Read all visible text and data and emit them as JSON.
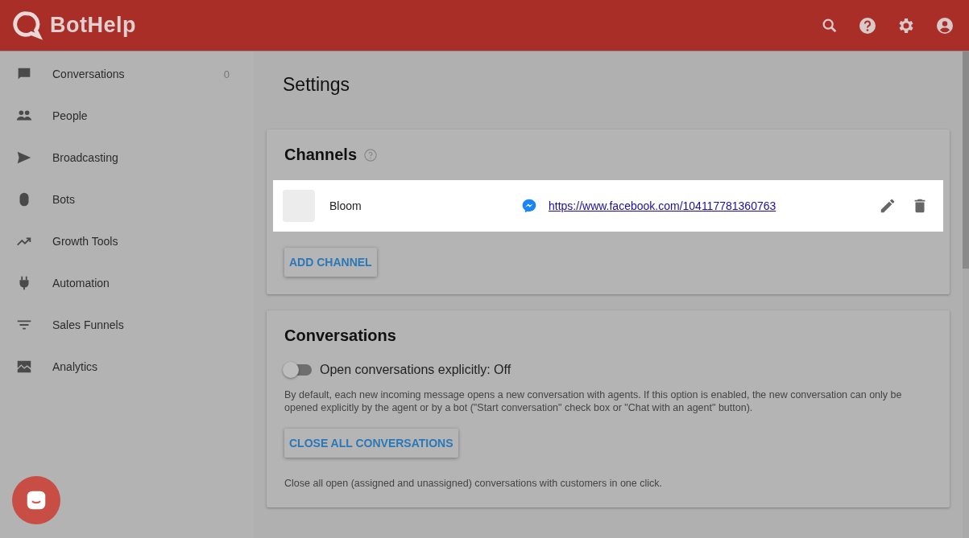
{
  "header": {
    "logo": "BotHelp"
  },
  "sidebar": {
    "items": [
      {
        "label": "Conversations",
        "count": "0"
      },
      {
        "label": "People"
      },
      {
        "label": "Broadcasting"
      },
      {
        "label": "Bots"
      },
      {
        "label": "Growth Tools"
      },
      {
        "label": "Automation"
      },
      {
        "label": "Sales Funnels"
      },
      {
        "label": "Analytics"
      }
    ]
  },
  "page_title": "Settings",
  "channels": {
    "title": "Channels",
    "items": [
      {
        "name": "Bloom",
        "url": "https://www.facebook.com/104117781360763"
      }
    ],
    "add_button": "ADD CHANNEL"
  },
  "conversations": {
    "title": "Conversations",
    "toggle": {
      "label": "Open conversations explicitly: Off",
      "on": false
    },
    "description": "By default, each new incoming message opens a new conversation with agents. If this option is enabled, the new conversation can only be opened explicitly by the agent or by a bot (\"Start conversation\" check box or \"Chat with an agent\" button).",
    "close_button": "CLOSE ALL CONVERSATIONS",
    "close_note": "Close all open (assigned and unassigned) conversations with customers in one click."
  }
}
